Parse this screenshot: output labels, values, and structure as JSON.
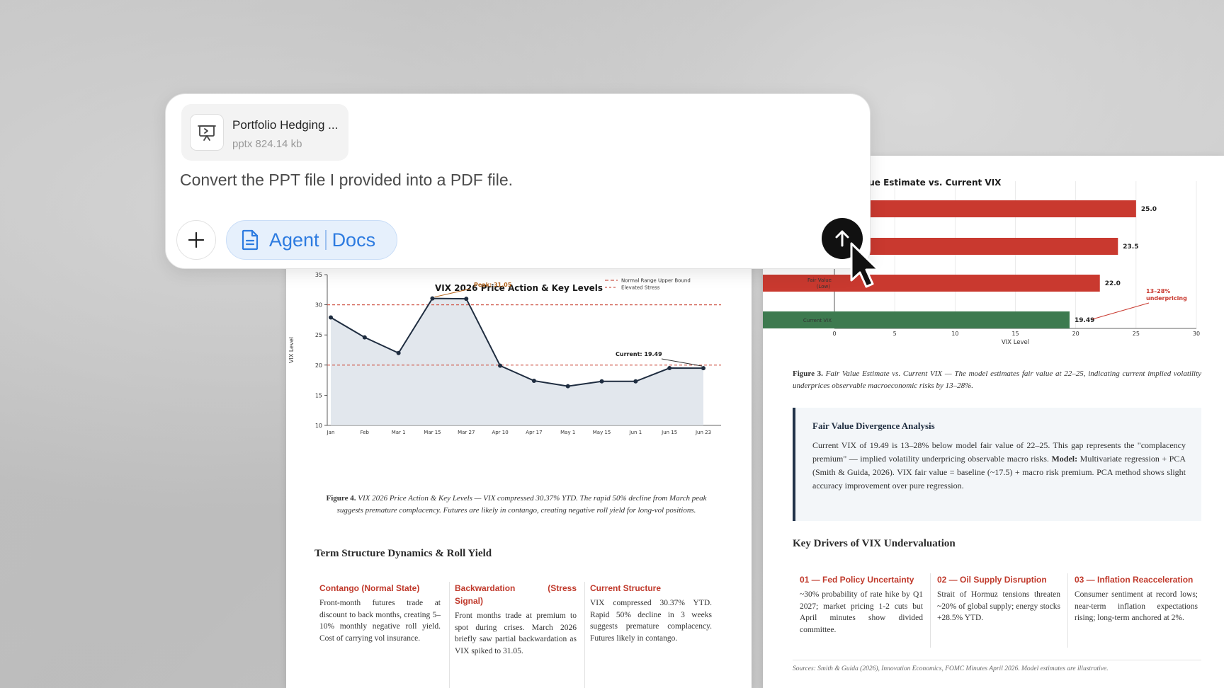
{
  "composer": {
    "file": {
      "name": "Portfolio Hedging ...",
      "meta": "pptx 824.14 kb",
      "icon": "presentation-file-icon"
    },
    "prompt": "Convert the PPT file I provided into a PDF file.",
    "mode": {
      "agent": "Agent",
      "docs": "Docs"
    },
    "accent": "#2d7be0"
  },
  "left_page": {
    "chart_data": {
      "type": "line",
      "title": "VIX 2026 Price Action & Key Levels",
      "ylabel": "VIX Level",
      "xlabel": "",
      "categories": [
        "Jan",
        "Feb",
        "Mar 1",
        "Mar 15",
        "Mar 27",
        "Apr 10",
        "Apr 17",
        "May 1",
        "May 15",
        "Jun 1",
        "Jun 15",
        "Jun 23"
      ],
      "values": [
        27.9,
        24.6,
        22.0,
        31.05,
        31.0,
        19.9,
        17.4,
        16.5,
        17.3,
        17.3,
        19.5,
        19.49
      ],
      "ylim": [
        10,
        35
      ],
      "yticks": [
        10,
        15,
        20,
        25,
        30,
        35
      ],
      "reference_lines": [
        {
          "name": "Normal Range Upper Bound",
          "value": 20
        },
        {
          "name": "Elevated Stress",
          "value": 30
        }
      ],
      "annotations": [
        {
          "text": "Peak: 31.05",
          "index": 3
        },
        {
          "text": "Current: 19.49",
          "index": 11
        }
      ],
      "legend": "top-right",
      "grid": false,
      "colors": {
        "line": "#1f2d40",
        "fill": "#dde3ea",
        "ref": "#d05a4b"
      }
    },
    "caption_fig": "Figure 4.",
    "caption_text": "VIX 2026 Price Action & Key Levels — VIX compressed 30.37% YTD. The rapid 50% decline from March peak suggests premature complacency. Futures are likely in contango, creating negative roll yield for long-vol positions.",
    "section_title": "Term Structure Dynamics & Roll Yield",
    "columns": [
      {
        "head": "Contango (Normal State)",
        "body": "Front-month futures trade at discount to back months, creating 5–10% monthly negative roll yield. Cost of carrying vol insurance."
      },
      {
        "head": "Backwardation (Stress Signal)",
        "body": "Front months trade at premium to spot during crises. March 2026 briefly saw partial backwardation as VIX spiked to 31.05."
      },
      {
        "head": "Current Structure",
        "body": "VIX compressed 30.37% YTD. Rapid 50% decline in 3 weeks suggests premature complacency. Futures likely in contango."
      }
    ]
  },
  "right_page": {
    "chart_data": {
      "type": "bar",
      "orientation": "horizontal",
      "title": "Fair Value Estimate vs. Current VIX",
      "xlabel": "VIX Level",
      "ylabel": "",
      "categories": [
        "",
        "",
        "Fair Value (Low)",
        "Current VIX"
      ],
      "values": [
        25.0,
        23.5,
        22.0,
        19.49
      ],
      "value_labels": [
        "25.0",
        "23.5",
        "22.0",
        "19.49"
      ],
      "xlim": [
        0,
        30
      ],
      "xticks": [
        0,
        5,
        10,
        15,
        20,
        25,
        30
      ],
      "annotation": "13–28% underpricing",
      "colors": {
        "fair": "#c9392f",
        "current": "#3d7a4f",
        "annotation": "#c9392f"
      }
    },
    "caption_fig": "Figure 3.",
    "caption_text": "Fair Value Estimate vs. Current VIX — The model estimates fair value at 22–25, indicating current implied volatility underprices observable macroeconomic risks by 13–28%.",
    "callout": {
      "title": "Fair Value Divergence Analysis",
      "body_1": "Current VIX of 19.49 is 13–28% below model fair value of 22–25. This gap represents the \"complacency premium\" — implied volatility underpricing observable macro risks. ",
      "body_bold": "Model:",
      "body_2": " Multivariate regression + PCA (Smith & Guida, 2026). VIX fair value = baseline (~17.5) + macro risk premium. PCA method shows slight accuracy improvement over pure regression."
    },
    "section_title": "Key Drivers of VIX Undervaluation",
    "drivers": [
      {
        "head": "01 — Fed Policy Uncertainty",
        "body": "~30% probability of rate hike by Q1 2027; market pricing 1-2 cuts but April minutes show divided committee."
      },
      {
        "head": "02 — Oil Supply Disruption",
        "body": "Strait of Hormuz tensions threaten ~20% of global supply; energy stocks +28.5% YTD."
      },
      {
        "head": "03 — Inflation Reacceleration",
        "body": "Consumer sentiment at record lows; near-term inflation expectations rising; long-term anchored at 2%."
      }
    ],
    "sources": "Sources: Smith & Guida (2026), Innovation Economics, FOMC Minutes April 2026. Model estimates are illustrative."
  }
}
